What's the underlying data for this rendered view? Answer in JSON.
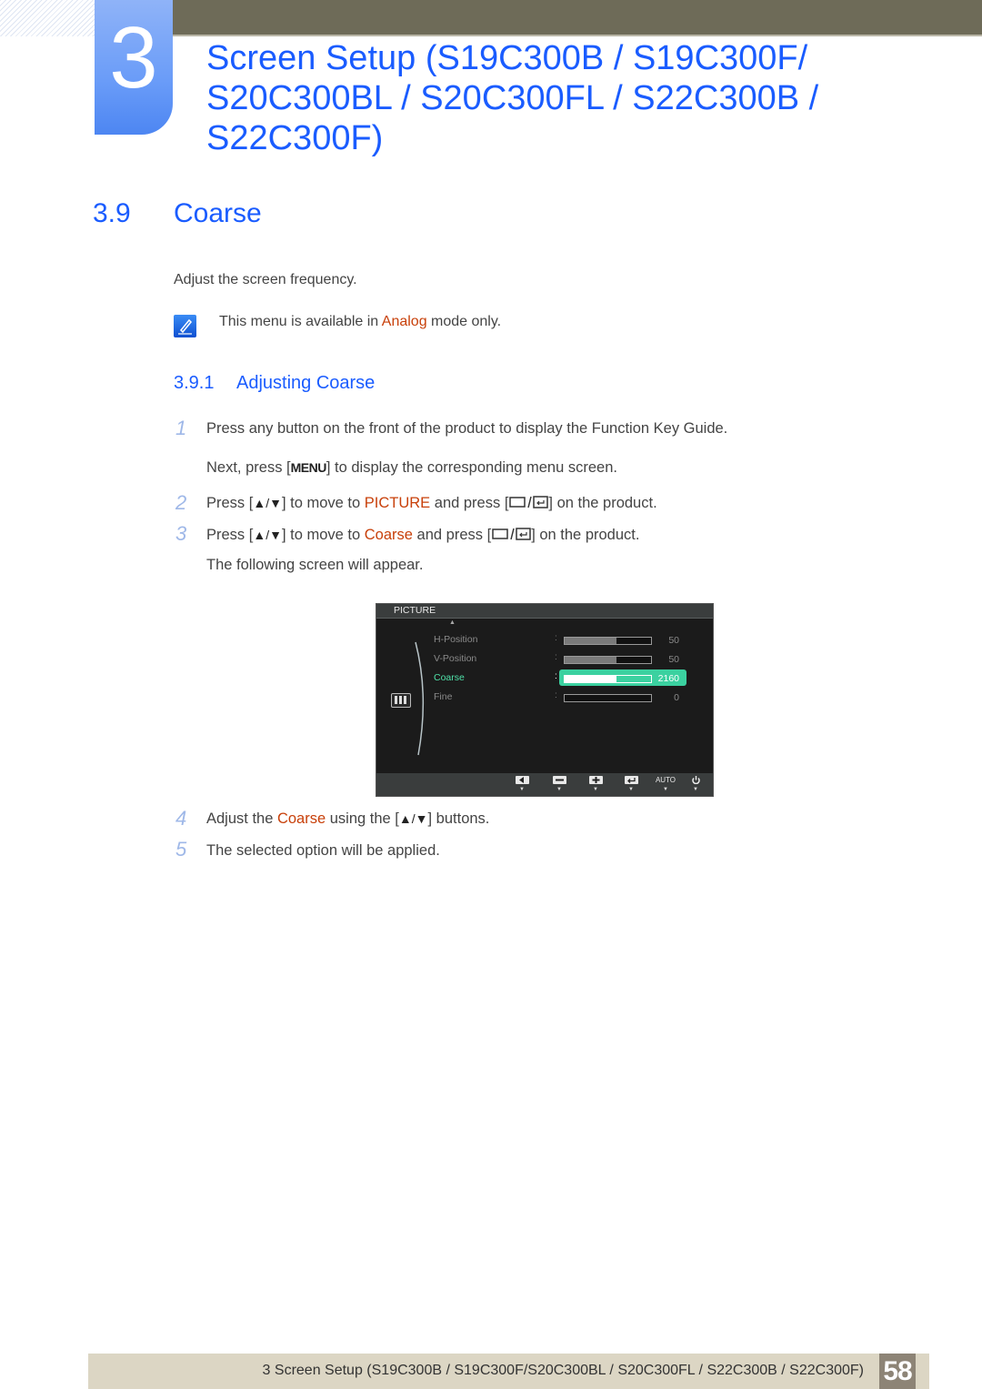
{
  "chapter": {
    "number": "3",
    "title_lines": [
      "Screen Setup (S19C300B / S19C300F/",
      "S20C300BL / S20C300FL / S22C300B /",
      "S22C300F)"
    ]
  },
  "section": {
    "number": "3.9",
    "title": "Coarse"
  },
  "intro": "Adjust the screen frequency.",
  "note": {
    "icon": "note-pencil-icon",
    "prefix": "This menu is available in ",
    "highlight": "Analog",
    "suffix": " mode only."
  },
  "subsection": {
    "number": "3.9.1",
    "title": "Adjusting Coarse"
  },
  "steps": [
    {
      "num": "1",
      "text": "Press any button on the front of the product to display the Function Key Guide."
    },
    {
      "num": "",
      "pre": "Next, press [",
      "key": "MENU",
      "post": "] to display the corresponding menu screen."
    },
    {
      "num": "2",
      "pre": "Press [",
      "keys": "▲/▼",
      "mid": "] to move to ",
      "highlight": "PICTURE",
      "mid2": " and press [",
      "post": "] on the product."
    },
    {
      "num": "3",
      "pre": "Press [",
      "keys": "▲/▼",
      "mid": "] to move to ",
      "highlight": "Coarse",
      "mid2": " and press [",
      "post": "] on the product."
    },
    {
      "num": "",
      "text": "The following screen will appear."
    },
    {
      "num": "4",
      "pre": "Adjust the ",
      "highlight": "Coarse",
      "mid": " using the [",
      "keys": "▲/▼",
      "post": "] buttons."
    },
    {
      "num": "5",
      "text": "The selected option will be applied."
    }
  ],
  "osd": {
    "header": "PICTURE",
    "rows": [
      {
        "label": "H-Position",
        "value": "50",
        "fill": 0.6,
        "selected": false
      },
      {
        "label": "V-Position",
        "value": "50",
        "fill": 0.6,
        "selected": false
      },
      {
        "label": "Coarse",
        "value": "2160",
        "fill": 0.6,
        "selected": true
      },
      {
        "label": "Fine",
        "value": "0",
        "fill": 0.0,
        "selected": false
      }
    ],
    "footer_buttons": [
      {
        "name": "left-icon"
      },
      {
        "name": "minus-icon"
      },
      {
        "name": "plus-icon"
      },
      {
        "name": "enter-icon"
      },
      {
        "name": "auto",
        "label": "AUTO"
      },
      {
        "name": "power-icon"
      }
    ]
  },
  "footer": {
    "text": "3 Screen Setup (S19C300B / S19C300F/S20C300BL / S20C300FL / S22C300B / S22C300F)",
    "page": "58"
  }
}
